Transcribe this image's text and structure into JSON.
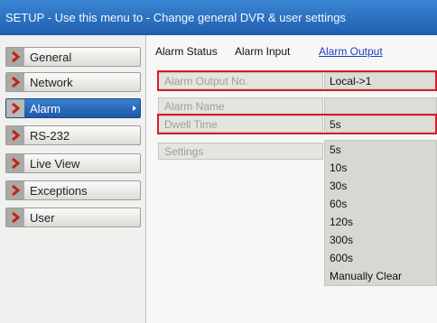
{
  "window": {
    "title": "SETUP - Use this menu to - Change general DVR & user settings"
  },
  "sidebar": {
    "items": [
      {
        "label": "General"
      },
      {
        "label": "Network"
      },
      {
        "label": "Alarm"
      },
      {
        "label": "RS-232"
      },
      {
        "label": "Live View"
      },
      {
        "label": "Exceptions"
      },
      {
        "label": "User"
      }
    ],
    "active_item": "Alarm"
  },
  "tabs": {
    "items": [
      {
        "label": "Alarm Status"
      },
      {
        "label": "Alarm Input"
      },
      {
        "label": "Alarm Output"
      }
    ],
    "selected": "Alarm Output"
  },
  "form": {
    "alarm_output_no": {
      "label": "Alarm Output No.",
      "value": "Local->1"
    },
    "alarm_name": {
      "label": "Alarm Name",
      "value": ""
    },
    "dwell_time": {
      "label": "Dwell Time",
      "value": "5s"
    },
    "settings": {
      "label": "Settings"
    }
  },
  "dwell_time_dropdown": {
    "options": [
      "5s",
      "10s",
      "30s",
      "60s",
      "120s",
      "300s",
      "600s",
      "Manually Clear"
    ]
  },
  "colors": {
    "title_bar": "#2a70c2",
    "selected_sidebar": "#2a6cc0",
    "highlight_box": "#d81c2a",
    "selected_tab": "#1c3fbf"
  },
  "icons": {
    "sidebar_item": "chevron-right-icon",
    "active_submenu": "arrow-right-icon"
  }
}
